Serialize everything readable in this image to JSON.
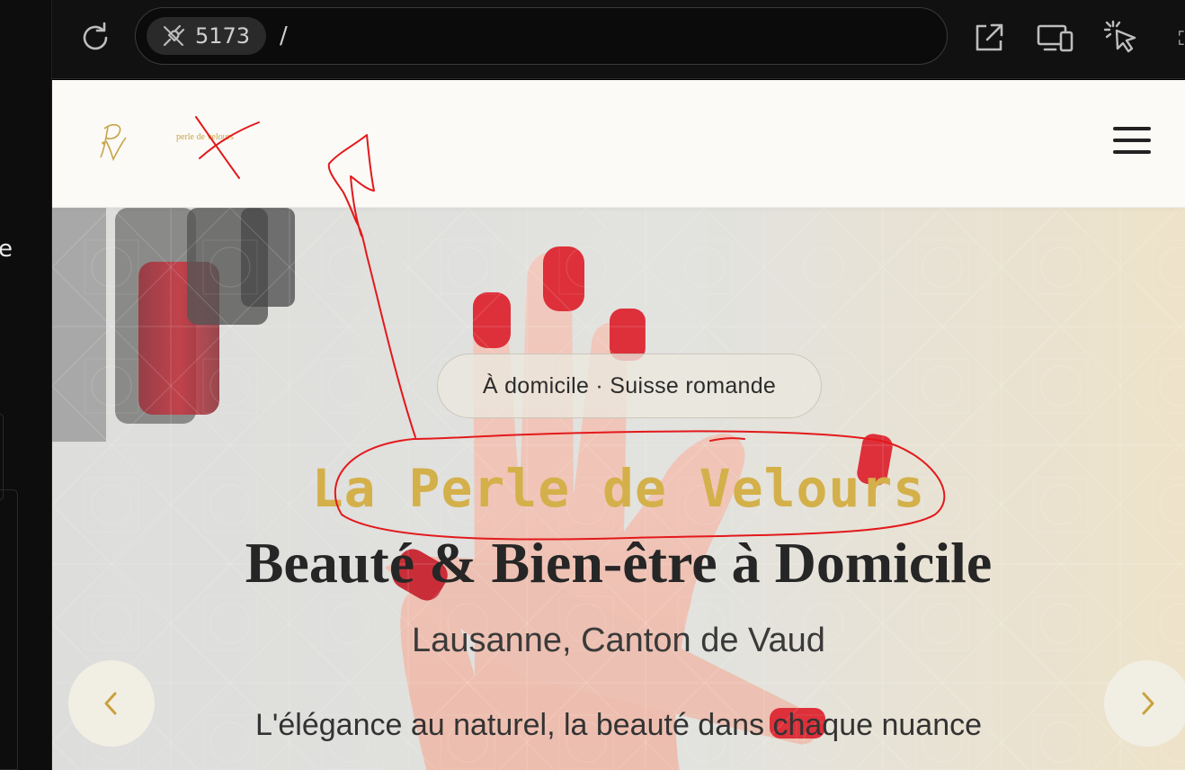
{
  "sidebar": {
    "partial_letter": "e"
  },
  "toolbar": {
    "port": "5173",
    "path": "/",
    "icons": {
      "reload": "reload-icon",
      "port": "plug-icon",
      "external": "open-external-icon",
      "devices": "responsive-devices-icon",
      "picker": "element-picker-icon",
      "fullscreen": "fullscreen-icon"
    }
  },
  "site": {
    "logo": {
      "monogram": "PV",
      "wordmark": "perle de velours"
    },
    "menu_icon": "hamburger-menu-icon"
  },
  "hero": {
    "badge": "À domicile · Suisse romande",
    "brand": "La Perle de Velours",
    "headline": "Beauté & Bien-être à Domicile",
    "location": "Lausanne, Canton de Vaud",
    "tagline": "L'élégance au naturel, la beauté dans chaque nuance",
    "prev_icon": "chevron-left-icon",
    "next_icon": "chevron-right-icon"
  },
  "colors": {
    "accent_gold": "#d4b04a",
    "annotation_red": "#e3191b",
    "nail_red": "#d9141f"
  }
}
